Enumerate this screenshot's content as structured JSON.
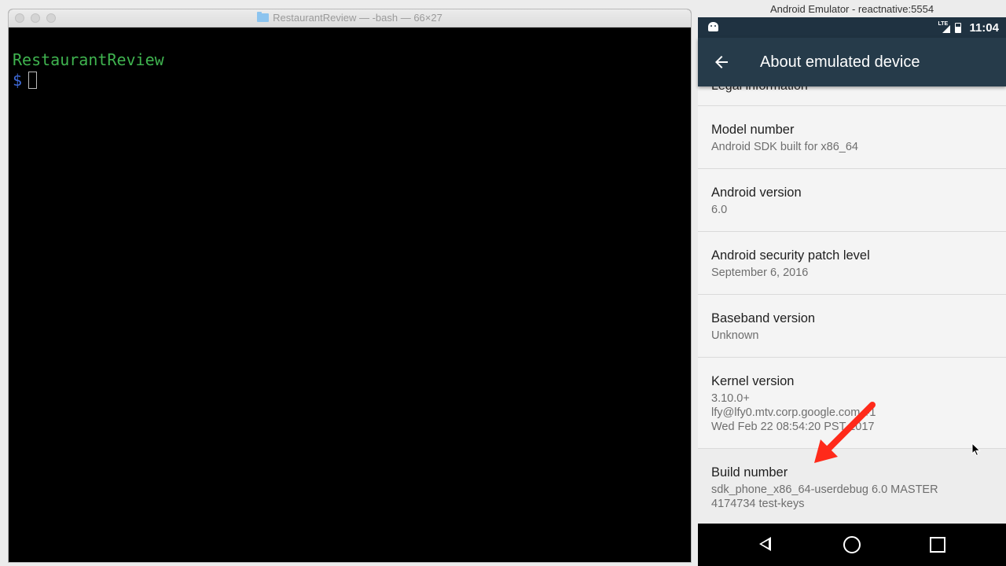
{
  "terminal": {
    "title": "RestaurantReview — -bash — 66×27",
    "dir_line": "RestaurantReview",
    "prompt": "$"
  },
  "emulator": {
    "window_title": "Android Emulator - reactnative:5554",
    "status": {
      "network": "LTE",
      "time": "11:04"
    },
    "appbar_title": "About emulated device",
    "partial_item": "Legal information",
    "items": [
      {
        "title": "Model number",
        "lines": [
          "Android SDK built for x86_64"
        ]
      },
      {
        "title": "Android version",
        "lines": [
          "6.0"
        ]
      },
      {
        "title": "Android security patch level",
        "lines": [
          "September 6, 2016"
        ]
      },
      {
        "title": "Baseband version",
        "lines": [
          "Unknown"
        ]
      },
      {
        "title": "Kernel version",
        "lines": [
          "3.10.0+",
          "lfy@lfy0.mtv.corp.google.com #1",
          "Wed Feb 22 08:54:20 PST 2017"
        ]
      },
      {
        "title": "Build number",
        "lines": [
          "sdk_phone_x86_64-userdebug 6.0 MASTER",
          "4174734 test-keys"
        ]
      }
    ]
  },
  "colors": {
    "terminal_dir": "#3fb34f",
    "terminal_prompt": "#3f6ad8",
    "appbar": "#263b4a",
    "statusbar": "#1f3241",
    "annotation_arrow": "#ff2a1a"
  }
}
